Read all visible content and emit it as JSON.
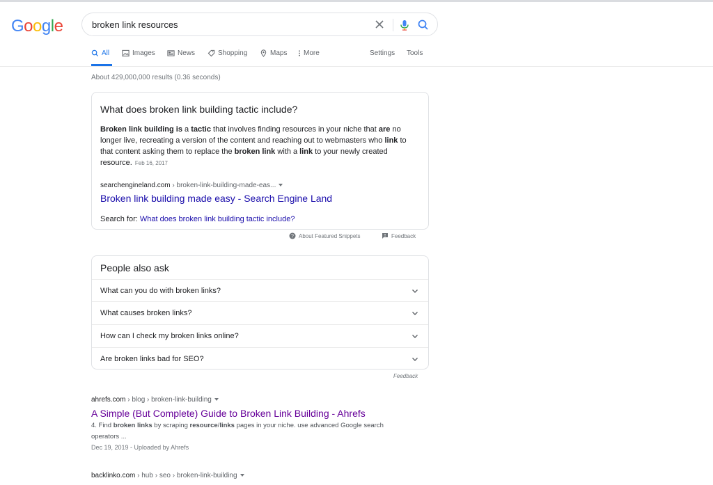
{
  "logo_text": "Google",
  "search": {
    "query": "broken link resources"
  },
  "tabs": {
    "all": "All",
    "images": "Images",
    "news": "News",
    "shopping": "Shopping",
    "maps": "Maps",
    "more": "More",
    "settings": "Settings",
    "tools": "Tools"
  },
  "stats": "About 429,000,000 results (0.36 seconds)",
  "snippet": {
    "question": "What does broken link building tactic include?",
    "date": "Feb 16, 2017",
    "site": "searchengineland.com",
    "crumbs": " › broken-link-building-made-eas...",
    "title": "Broken link building made easy - Search Engine Land",
    "search_for_label": "Search for:",
    "search_for_link": "What does broken link building tactic include?",
    "about_label": "About Featured Snippets",
    "feedback_label": "Feedback"
  },
  "paa": {
    "title": "People also ask",
    "questions": [
      "What can you do with broken links?",
      "What causes broken links?",
      "How can I check my broken links online?",
      "Are broken links bad for SEO?"
    ],
    "feedback": "Feedback"
  },
  "results": [
    {
      "site": "ahrefs.com",
      "crumbs": " › blog › broken-link-building",
      "title": "A Simple (But Complete) Guide to Broken Link Building - Ahrefs",
      "meta": "Dec 19, 2019 - Uploaded by Ahrefs"
    },
    {
      "site": "backlinko.com",
      "crumbs": " › hub › seo › broken-link-building"
    }
  ],
  "colors": {
    "link": "#1a0dab",
    "visited": "#660099",
    "accent": "#1a73e8"
  }
}
